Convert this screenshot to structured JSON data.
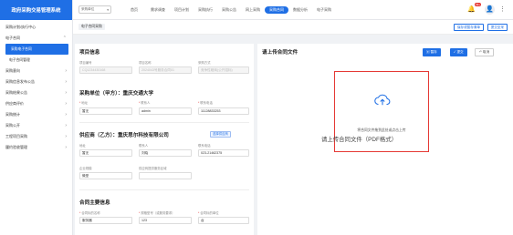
{
  "app": {
    "title": "政府采购交易管理系统"
  },
  "sidebar": {
    "items": [
      {
        "label": "采购计划/执行中心",
        "arrow": ""
      },
      {
        "label": "电子合同",
        "arrow": "⌃"
      },
      {
        "label": "采购电子合同",
        "arrow": "",
        "sub": true,
        "active": true
      },
      {
        "label": "电子合同管理",
        "arrow": "",
        "sub": true
      },
      {
        "label": "采购意向",
        "arrow": "›"
      },
      {
        "label": "采购信息发布公告",
        "arrow": "›"
      },
      {
        "label": "采购结果公告",
        "arrow": "›"
      },
      {
        "label": "供应商评价",
        "arrow": "›"
      },
      {
        "label": "采购统计",
        "arrow": "›"
      },
      {
        "label": "采购公开",
        "arrow": "›"
      },
      {
        "label": "工程项目采购",
        "arrow": "›"
      },
      {
        "label": "履约验收管理",
        "arrow": "›"
      }
    ]
  },
  "top": {
    "select": "采购单位",
    "nav": [
      "首页",
      "需求调查",
      "项目计划",
      "采购执行",
      "采购公告",
      "网上采购",
      "采购合同",
      "数据分析",
      "电子采购"
    ],
    "nav_active": 6,
    "badge": "99+"
  },
  "bar": {
    "tag": "电子合同采购",
    "btn1": "保存或暂存清单",
    "btn2": "提交至采"
  },
  "project": {
    "title": "项目信息",
    "f1_label": "项目编号",
    "f1_value": "CQ1234430168",
    "f2_label": "项目名称",
    "f2_value": "2024043号服务合同01",
    "f3_label": "采购方式",
    "f3_value": "竞争性磋商(公开招标)"
  },
  "buyer": {
    "title": "采购单位（甲方）：重庆交通大学",
    "f1_label": "地址",
    "f1_value": "暂无",
    "f2_label": "联系人",
    "f2_value": "admin",
    "f3_label": "联系电话",
    "f3_value": "11128833253"
  },
  "supplier": {
    "title": "供应商（乙方）：重庆思尔科技有限公司",
    "chip": "选择供应商",
    "f1_label": "地址",
    "f1_value": "暂无",
    "f2_label": "联系人",
    "f2_value": "刘晓",
    "f3_label": "联系电话",
    "f3_value": "023-21462375",
    "f4_label": "企业规模",
    "f4_value": "微型",
    "f5_label": "供应商提供服务区域",
    "f5_value": ""
  },
  "contract": {
    "title": "合同主要信息",
    "f1_label": "合同标的名称",
    "f1_value": "服务器",
    "f2_label": "规格型号（或服务要求）",
    "f2_value": "123",
    "f3_label": "合同标的单位",
    "f3_value": "台"
  },
  "upload": {
    "title": "请上传合同文件",
    "btn_save": "暂存",
    "btn_submit": "提交",
    "btn_back": "取消",
    "drop_text": "将合同文件拖到此处或点击上传",
    "caption": "请上传合同文件（PDF格式）"
  }
}
